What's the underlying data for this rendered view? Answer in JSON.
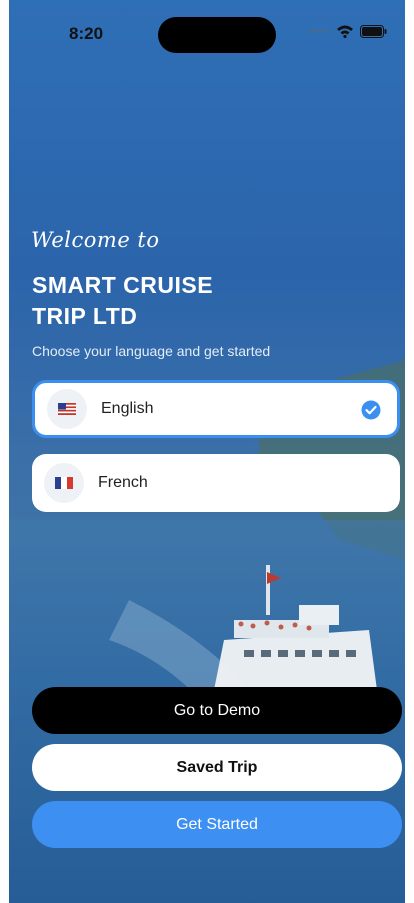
{
  "status_bar": {
    "time": "8:20"
  },
  "welcome": {
    "script_text": "Welcome to",
    "title_line1": "SMART CRUISE",
    "title_line2": "TRIP LTD",
    "subtitle": "Choose your language and get started"
  },
  "languages": [
    {
      "label": "English",
      "flag": "us-flag-icon",
      "selected": true
    },
    {
      "label": "French",
      "flag": "fr-flag-icon",
      "selected": false
    }
  ],
  "buttons": {
    "demo": "Go to Demo",
    "saved": "Saved Trip",
    "start": "Get Started"
  },
  "colors": {
    "accent": "#3d8ff2",
    "selected_border": "#3b8ff0",
    "demo_button": "#000000"
  }
}
